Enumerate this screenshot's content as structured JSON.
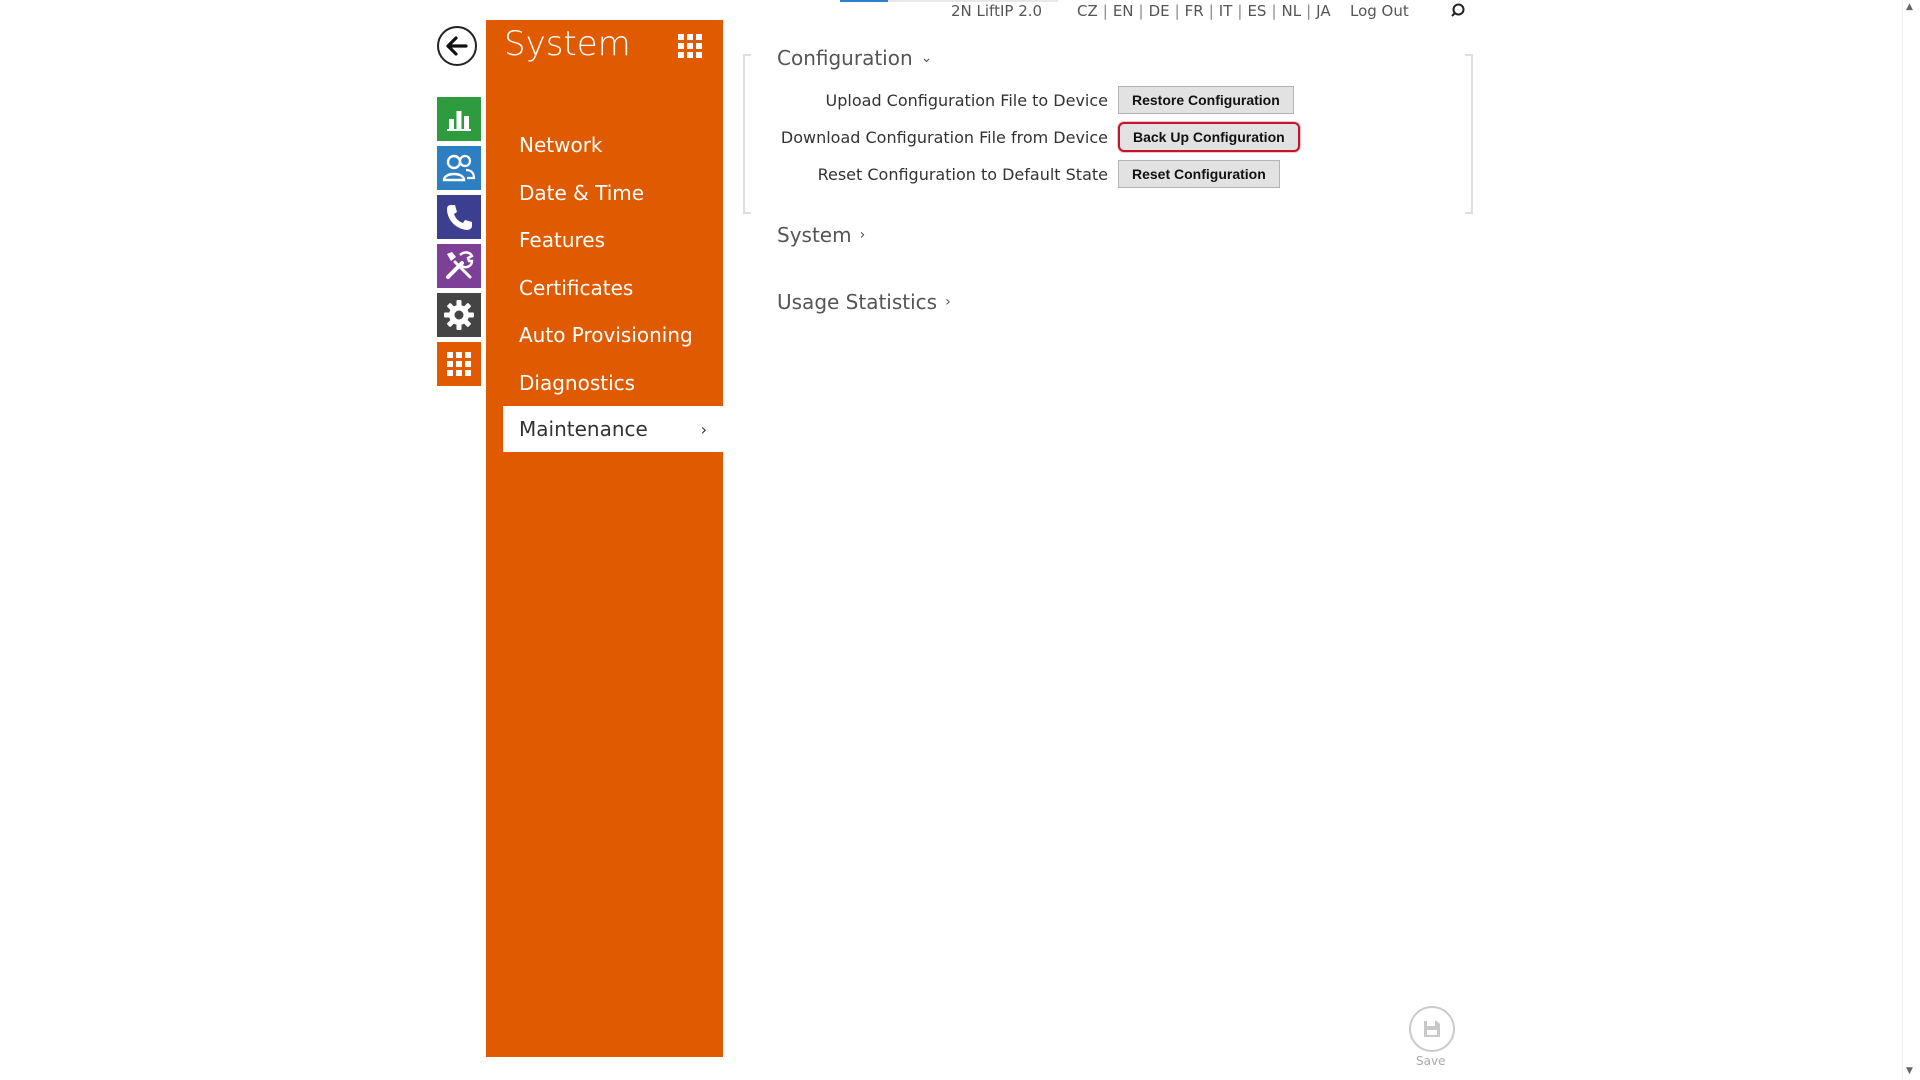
{
  "topbar": {
    "device_name": "2N LiftIP 2.0",
    "languages": [
      "CZ",
      "EN",
      "DE",
      "FR",
      "IT",
      "ES",
      "NL",
      "JA"
    ],
    "logout": "Log Out"
  },
  "panel": {
    "title": "System",
    "items": [
      {
        "label": "Network"
      },
      {
        "label": "Date & Time"
      },
      {
        "label": "Features"
      },
      {
        "label": "Certificates"
      },
      {
        "label": "Auto Provisioning"
      },
      {
        "label": "Diagnostics"
      },
      {
        "label": "Maintenance"
      }
    ],
    "active_index": 6
  },
  "iconbar": {
    "tiles": [
      {
        "icon": "bar-chart-icon",
        "color": "#2e9c3e"
      },
      {
        "icon": "users-icon",
        "color": "#2e7fc1"
      },
      {
        "icon": "phone-icon",
        "color": "#3c3f8f"
      },
      {
        "icon": "tools-icon",
        "color": "#7d3f98"
      },
      {
        "icon": "gear-icon",
        "color": "#444444"
      },
      {
        "icon": "grid-icon",
        "color": "#e05a00"
      }
    ]
  },
  "content": {
    "sections": {
      "configuration": "Configuration",
      "system": "System",
      "usage": "Usage Statistics"
    },
    "rows": [
      {
        "label": "Upload Configuration File to Device",
        "button": "Restore Configuration"
      },
      {
        "label": "Download Configuration File from Device",
        "button": "Back Up Configuration"
      },
      {
        "label": "Reset Configuration to Default State",
        "button": "Reset Configuration"
      }
    ],
    "save_label": "Save"
  },
  "colors": {
    "accent": "#e05a00",
    "focus": "#c0152f"
  }
}
